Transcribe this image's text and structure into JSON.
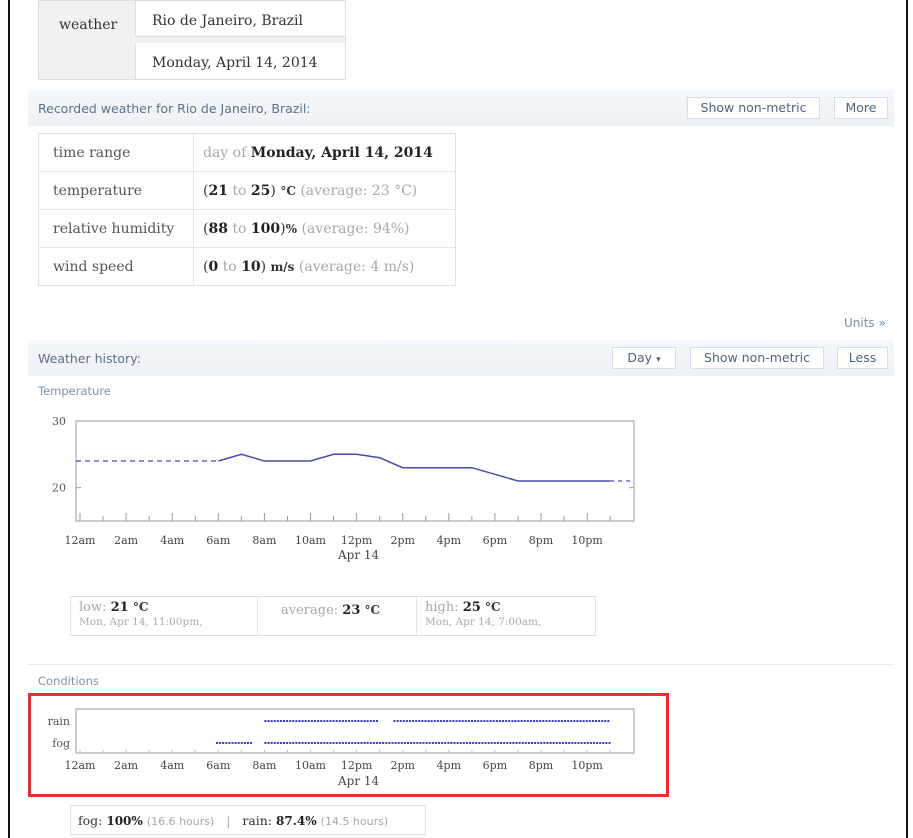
{
  "input": {
    "label": "weather",
    "location": "Rio de Janeiro, Brazil",
    "date": "Monday, April 14, 2014"
  },
  "recorded": {
    "title": "Recorded weather for Rio de Janeiro, Brazil:",
    "btn_non_metric": "Show non-metric",
    "btn_more": "More",
    "rows": [
      {
        "key": "time range",
        "pre": "day of",
        "main": "Monday, April 14, 2014"
      },
      {
        "key": "temperature",
        "low": "21",
        "high": "25",
        "unit": "°C",
        "avg": "(average: 23 °C)"
      },
      {
        "key": "relative humidity",
        "low": "88",
        "high": "100",
        "unit": "%",
        "avg": "(average: 94%)"
      },
      {
        "key": "wind speed",
        "low": "0",
        "high": "10",
        "unit": "m/s",
        "avg": "(average: 4 m/s)"
      }
    ]
  },
  "units_link": "Units »",
  "history": {
    "title": "Weather history:",
    "btn_day": "Day",
    "btn_non_metric": "Show non-metric",
    "btn_less": "Less"
  },
  "temperature_label": "Temperature",
  "conditions_label": "Conditions",
  "stats": {
    "low_label": "low:",
    "low_value": "21",
    "low_unit": "°C",
    "low_time": "Mon, Apr 14, 11:00pm,",
    "avg_label": "average:",
    "avg_value": "23",
    "avg_unit": "°C",
    "high_label": "high:",
    "high_value": "25",
    "high_unit": "°C",
    "high_time": "Mon, Apr 14, 7:00am,"
  },
  "conditions_summary": {
    "fog_label": "fog:",
    "fog_value": "100%",
    "fog_hours": "(16.6 hours)",
    "sep": "|",
    "rain_label": "rain:",
    "rain_value": "87.4%",
    "rain_hours": "(14.5 hours)"
  },
  "chart_data": [
    {
      "type": "line",
      "title": "Temperature",
      "x": [
        "12am",
        "1am",
        "2am",
        "3am",
        "4am",
        "5am",
        "6am",
        "7am",
        "8am",
        "9am",
        "10am",
        "11am",
        "12pm",
        "1pm",
        "2pm",
        "3pm",
        "4pm",
        "5pm",
        "6pm",
        "7pm",
        "8pm",
        "9pm",
        "10pm",
        "11pm"
      ],
      "values": [
        24,
        24,
        24,
        24,
        24,
        24,
        24,
        25,
        24,
        24,
        24,
        25,
        25,
        24.5,
        23,
        23,
        23,
        23,
        22,
        21,
        21,
        21,
        21,
        21
      ],
      "measured_from": "6am",
      "x_tick_labels": [
        "12am",
        "2am",
        "4am",
        "6am",
        "8am",
        "10am",
        "12pm",
        "2pm",
        "4pm",
        "6pm",
        "8pm",
        "10pm"
      ],
      "date_label": "Apr 14",
      "ylim": [
        15,
        30
      ],
      "y_ticks": [
        20,
        30
      ],
      "color": "#4a4aa8"
    },
    {
      "type": "scatter",
      "title": "Conditions",
      "rows": [
        "rain",
        "fog"
      ],
      "rain_intervals": [
        [
          8.0,
          12.9
        ],
        [
          13.6,
          23.0
        ]
      ],
      "fog_intervals": [
        [
          5.9,
          7.5
        ],
        [
          8.0,
          23.0
        ]
      ],
      "x_tick_labels": [
        "12am",
        "2am",
        "4am",
        "6am",
        "8am",
        "10am",
        "12pm",
        "2pm",
        "4pm",
        "6pm",
        "8pm",
        "10pm"
      ],
      "date_label": "Apr 14",
      "color": "#3a3ad0"
    }
  ]
}
